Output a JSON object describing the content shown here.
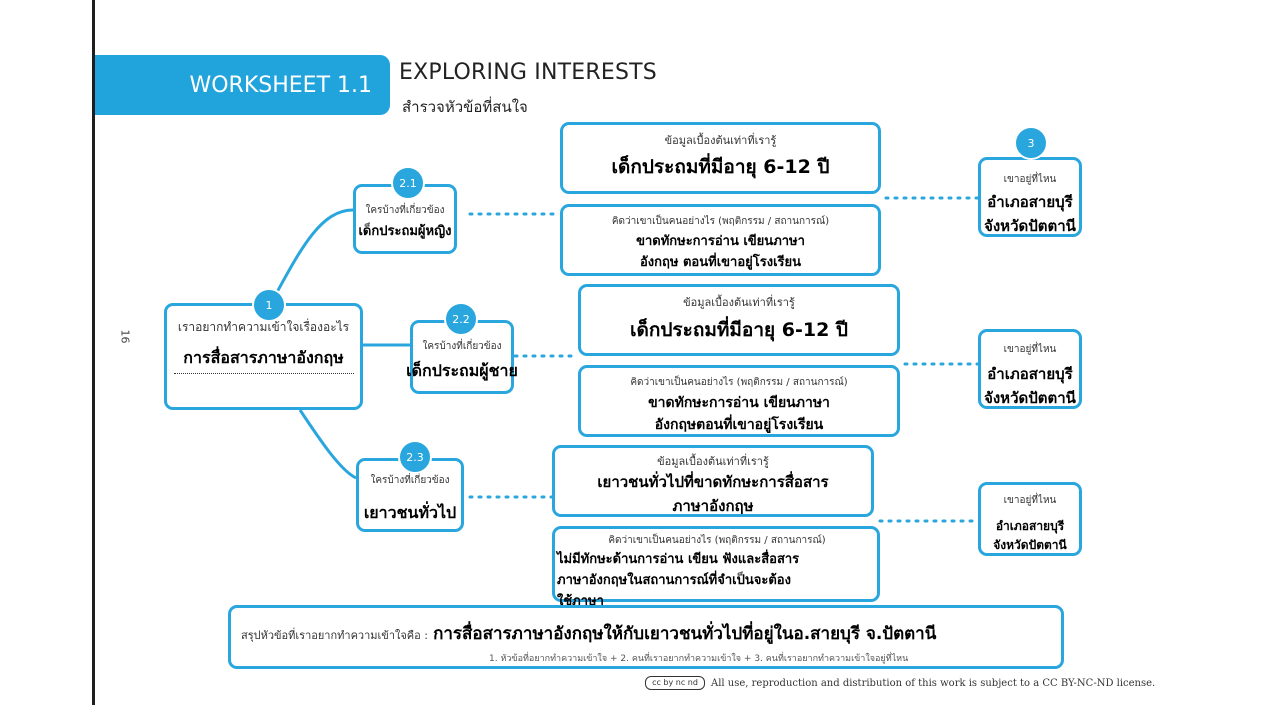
{
  "page_number": "16",
  "header": {
    "worksheet_label": "WORKSHEET 1.1",
    "title": "EXPLORING INTERESTS",
    "subtitle": "สำรวจหัวข้อที่สนใจ"
  },
  "topic": {
    "number": "1",
    "label": "เราอยากทำความเข้าใจเรื่องอะไร",
    "value": "การสื่อสารภาษาอังกฤษ"
  },
  "groups": [
    {
      "number": "2.1",
      "who_label": "ใครบ้างที่เกี่ยวข้อง",
      "who_value": "เด็กประถมผู้หญิง",
      "facts_label": "ข้อมูลเบื้องต้นเท่าที่เรารู้",
      "facts_value": "เด็กประถมที่มีอายุ 6-12 ปี",
      "think_label": "คิดว่าเขาเป็นคนอย่างไร (พฤติกรรม / สถานการณ์)",
      "think_value_1": "ขาดทักษะการอ่าน เขียนภาษา",
      "think_value_2": "อังกฤษ ตอนที่เขาอยู่โรงเรียน",
      "where_label": "เขาอยู่ที่ไหน",
      "where_value_1": "อำเภอสายบุรี",
      "where_value_2": "จังหวัดปัตตานี"
    },
    {
      "number": "2.2",
      "who_label": "ใครบ้างที่เกี่ยวข้อง",
      "who_value": "เด็กประถมผู้ชาย",
      "facts_label": "ข้อมูลเบื้องต้นเท่าที่เรารู้",
      "facts_value": "เด็กประถมที่มีอายุ 6-12 ปี",
      "think_label": "คิดว่าเขาเป็นคนอย่างไร (พฤติกรรม / สถานการณ์)",
      "think_value_1": "ขาดทักษะการอ่าน เขียนภาษา",
      "think_value_2": "อังกฤษตอนที่เขาอยู่โรงเรียน",
      "where_label": "เขาอยู่ที่ไหน",
      "where_value_1": "อำเภอสายบุรี",
      "where_value_2": "จังหวัดปัตตานี"
    },
    {
      "number": "2.3",
      "who_label": "ใครบ้างที่เกี่ยวข้อง",
      "who_value": "เยาวชนทั่วไป",
      "facts_label": "ข้อมูลเบื้องต้นเท่าที่เรารู้",
      "facts_value_1": "เยาวชนทั่วไปที่ขาดทักษะการสื่อสาร",
      "facts_value_2": "ภาษาอังกฤษ",
      "think_label": "คิดว่าเขาเป็นคนอย่างไร (พฤติกรรม / สถานการณ์)",
      "think_value_1": "ไม่มีทักษะด้านการอ่าน เขียน ฟังและสื่อสาร",
      "think_value_2": "ภาษาอังกฤษในสถานการณ์ที่จำเป็นจะต้อง",
      "think_value_3": "ใช้ภาษา",
      "where_label": "เขาอยู่ที่ไหน",
      "where_value_1": "อำเภอสายบุรี",
      "where_value_2": "จังหวัดปัตตานี"
    }
  ],
  "where_number": "3",
  "summary": {
    "label": "สรุปหัวข้อที่เราอยากทำความเข้าใจคือ :",
    "value": "การสื่อสารภาษาอังกฤษให้กับเยาวชนทั่วไปที่อยู่ในอ.สายบุรี จ.ปัตตานี",
    "hint": "1. หัวข้อที่อยากทำความเข้าใจ + 2. คนที่เราอยากทำความเข้าใจ + 3. คนที่เราอยากทำความเข้าใจอยู่ที่ไหน"
  },
  "footer": {
    "license_badge": "cc by nc nd",
    "license_text": "All use, reproduction and distribution of this work is subject to a CC BY-NC-ND license."
  },
  "colors": {
    "accent": "#29a6dd",
    "banner": "#21a3dc"
  }
}
